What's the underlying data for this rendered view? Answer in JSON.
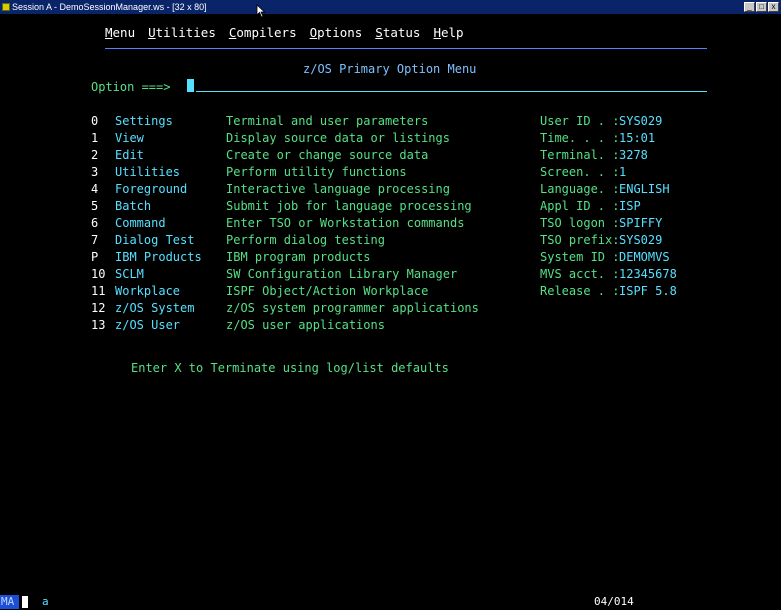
{
  "window": {
    "title": "Session A - DemoSessionManager.ws - [32 x 80]",
    "buttons": [
      "_",
      "□",
      "x"
    ]
  },
  "menu": [
    {
      "underline": "M",
      "rest": "enu"
    },
    {
      "underline": "U",
      "rest": "tilities"
    },
    {
      "underline": "C",
      "rest": "ompilers"
    },
    {
      "underline": "O",
      "rest": "ptions"
    },
    {
      "underline": "S",
      "rest": "tatus"
    },
    {
      "underline": "H",
      "rest": "elp"
    }
  ],
  "panel_title": "z/OS Primary Option Menu",
  "option_prompt": "Option ===>",
  "option_value": "",
  "options": [
    {
      "num": "0",
      "name": "Settings",
      "desc": "Terminal and user parameters"
    },
    {
      "num": "1",
      "name": "View",
      "desc": "Display source data or listings"
    },
    {
      "num": "2",
      "name": "Edit",
      "desc": "Create or change source data"
    },
    {
      "num": "3",
      "name": "Utilities",
      "desc": "Perform utility functions"
    },
    {
      "num": "4",
      "name": "Foreground",
      "desc": "Interactive language processing"
    },
    {
      "num": "5",
      "name": "Batch",
      "desc": "Submit job for language processing"
    },
    {
      "num": "6",
      "name": "Command",
      "desc": "Enter TSO or Workstation commands"
    },
    {
      "num": "7",
      "name": "Dialog Test",
      "desc": "Perform dialog testing"
    },
    {
      "num": "P",
      "name": "IBM Products",
      "desc": "IBM program products"
    },
    {
      "num": "10",
      "name": "SCLM",
      "desc": "SW Configuration Library Manager"
    },
    {
      "num": "11",
      "name": "Workplace",
      "desc": "ISPF Object/Action Workplace"
    },
    {
      "num": "12",
      "name": "z/OS System",
      "desc": "z/OS system programmer applications"
    },
    {
      "num": "13",
      "name": "z/OS User",
      "desc": "z/OS user applications"
    }
  ],
  "info": [
    {
      "label": "User ID . :",
      "value": "SYS029"
    },
    {
      "label": "Time. . . :",
      "value": "15:01"
    },
    {
      "label": "Terminal. :",
      "value": "3278"
    },
    {
      "label": "Screen. . :",
      "value": "1"
    },
    {
      "label": "Language. :",
      "value": "ENGLISH"
    },
    {
      "label": "Appl ID . :",
      "value": "ISP"
    },
    {
      "label": "TSO logon :",
      "value": "SPIFFY"
    },
    {
      "label": "TSO prefix:",
      "value": "SYS029"
    },
    {
      "label": "System ID :",
      "value": "DEMOMVS"
    },
    {
      "label": "MVS acct. :",
      "value": "12345678"
    },
    {
      "label": "Release . :",
      "value": "ISPF 5.8"
    }
  ],
  "terminate_text": "Enter X to Terminate using log/list defaults",
  "status": {
    "mode": "MA",
    "indicator": "a",
    "cursor_position": "04/014"
  },
  "colors": {
    "background": "#000000",
    "white": "#ffffff",
    "green": "#56e086",
    "turquoise": "#56e0ff",
    "blue_title": "#7ec0ff",
    "separator": "#4f86ff",
    "titlebar": "#0a246a"
  }
}
